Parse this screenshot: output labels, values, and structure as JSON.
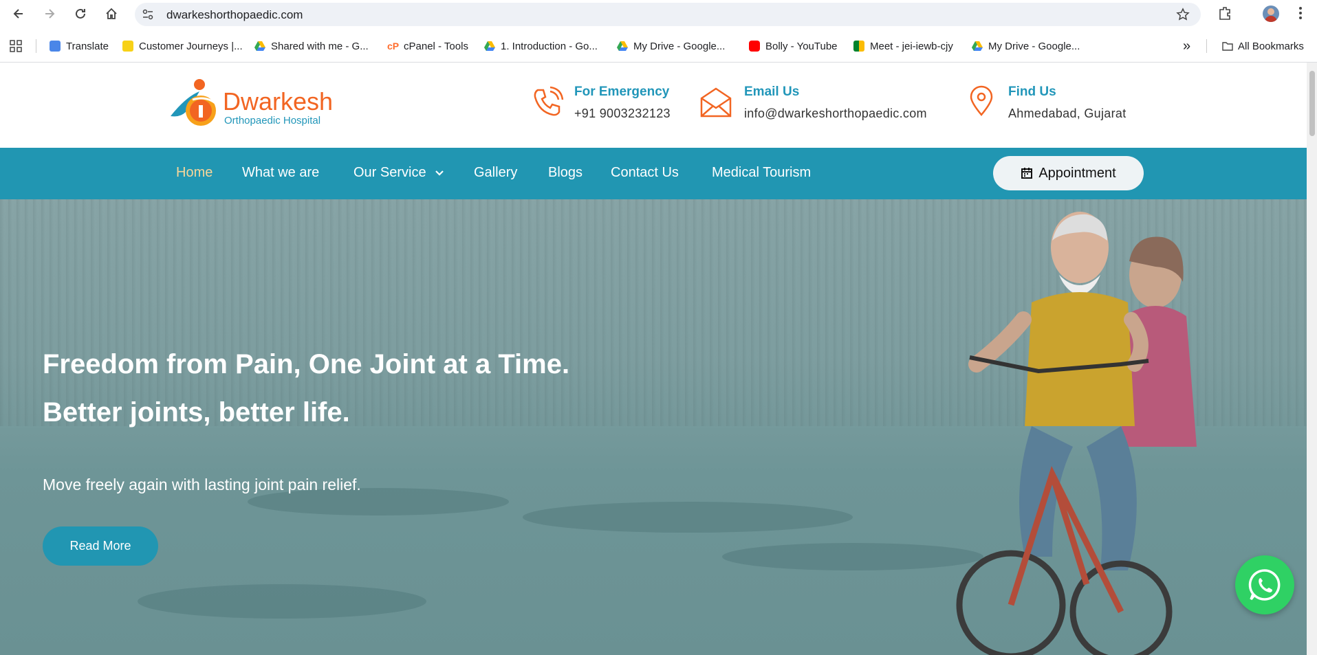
{
  "browser": {
    "url": "dwarkeshorthopaedic.com",
    "bookmarks": [
      {
        "label": "Translate",
        "icon": "google-translate-icon"
      },
      {
        "label": "Customer Journeys |...",
        "icon": "customer-journeys-icon"
      },
      {
        "label": "Shared with me - G...",
        "icon": "google-drive-icon"
      },
      {
        "label": "cPanel - Tools",
        "icon": "cpanel-icon"
      },
      {
        "label": "1. Introduction - Go...",
        "icon": "google-drive-icon"
      },
      {
        "label": "My Drive - Google...",
        "icon": "google-drive-icon"
      },
      {
        "label": "Bolly - YouTube",
        "icon": "youtube-icon"
      },
      {
        "label": "Meet - jei-iewb-cjy",
        "icon": "google-meet-icon"
      },
      {
        "label": "My Drive - Google...",
        "icon": "google-drive-icon"
      }
    ],
    "all_bookmarks": "All Bookmarks",
    "overflow": "»"
  },
  "site": {
    "logo_name": "Dwarkesh",
    "logo_sub": "Orthopaedic Hospital",
    "emergency": {
      "title": "For Emergency",
      "value": "+91 9003232123"
    },
    "email": {
      "title": "Email Us",
      "value": "info@dwarkeshorthopaedic.com"
    },
    "find": {
      "title": "Find Us",
      "value": "Ahmedabad, Gujarat"
    },
    "nav": {
      "home": "Home",
      "what": "What we are",
      "service": "Our Service",
      "gallery": "Gallery",
      "blogs": "Blogs",
      "contact": "Contact Us",
      "tourism": "Medical Tourism"
    },
    "appointment": "Appointment",
    "hero": {
      "line1": "Freedom from Pain, One Joint at a Time.",
      "line2": "Better joints, better life.",
      "subtitle": "Move freely again with lasting joint pain relief.",
      "button": "Read More"
    }
  },
  "colors": {
    "brand_orange": "#f26522",
    "brand_teal": "#2196b2",
    "nav_active": "#f8d69a",
    "whatsapp": "#2fd164"
  }
}
